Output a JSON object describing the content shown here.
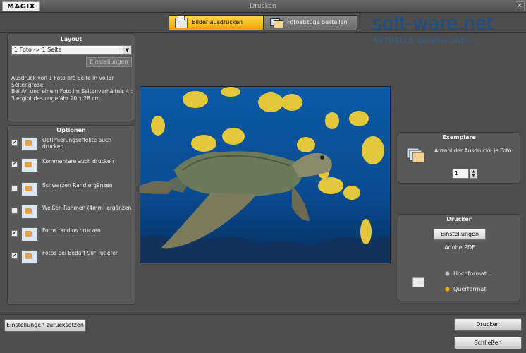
{
  "window": {
    "logo": "MAGIX",
    "title": "Drucken",
    "close_glyph": "✕"
  },
  "tabs": [
    {
      "label": "Bilder ausdrucken",
      "active": true,
      "icon": "printer-icon"
    },
    {
      "label": "Fotoabzüge bestellen",
      "active": false,
      "icon": "photos-icon"
    }
  ],
  "watermark": {
    "title": "soft-ware.net",
    "subtitle": "AKTUELLE DOWNLOADS"
  },
  "layout": {
    "title": "Layout",
    "selected": "1 Foto  -> 1 Seite",
    "dropdown_glyph": "▼",
    "settings_label": "Einstellungen",
    "description": "Ausdruck von 1 Foto pro Seite in voller Seitengröße.\nBei A4 und einem Foto im Seitenverhältnis 4 : 3 ergibt das ungefähr 20 x 28 cm."
  },
  "options": {
    "title": "Optionen",
    "check_glyph": "✔",
    "items": [
      {
        "label": "Optimierungseffekte auch drucken",
        "checked": true
      },
      {
        "label": "Kommentare auch drucken",
        "checked": true
      },
      {
        "label": "Schwarzen Rand ergänzen",
        "checked": false
      },
      {
        "label": "Weißen Rahmen (4mm) ergänzen",
        "checked": false
      },
      {
        "label": "Fotos randlos drucken",
        "checked": true
      },
      {
        "label": "Fotos bei Bedarf 90° rotieren",
        "checked": true
      }
    ]
  },
  "copies": {
    "title": "Exemplare",
    "label": "Anzahl der Ausdrucke je Foto:",
    "value": "1",
    "spin_up": "▲",
    "spin_down": "▼"
  },
  "printer": {
    "title": "Drucker",
    "settings_label": "Einstellungen",
    "name": "Adobe PDF",
    "portrait_label": "Hochformat",
    "landscape_label": "Querformat",
    "orientation": "landscape"
  },
  "buttons": {
    "reset": "Einstellungen zurücksetzen",
    "print": "Drucken",
    "close": "Schließen"
  },
  "colors": {
    "accent": "#f5b31e",
    "background": "#4d4d4d",
    "watermark": "#1b4f8a"
  }
}
